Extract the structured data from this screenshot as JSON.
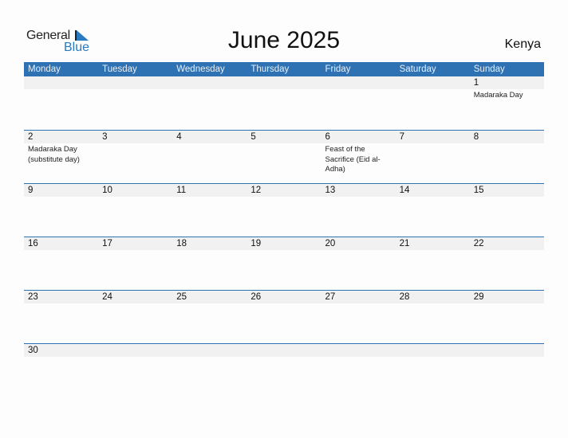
{
  "logo": {
    "word1": "General",
    "word2": "Blue",
    "accent": "#2a7ac0"
  },
  "title": "June 2025",
  "country": "Kenya",
  "colors": {
    "header_bg": "#2e72b3",
    "band_bg": "#f1f1f1"
  },
  "weekdays": [
    "Monday",
    "Tuesday",
    "Wednesday",
    "Thursday",
    "Friday",
    "Saturday",
    "Sunday"
  ],
  "weeks": [
    [
      {
        "day": "",
        "holiday": ""
      },
      {
        "day": "",
        "holiday": ""
      },
      {
        "day": "",
        "holiday": ""
      },
      {
        "day": "",
        "holiday": ""
      },
      {
        "day": "",
        "holiday": ""
      },
      {
        "day": "",
        "holiday": ""
      },
      {
        "day": "1",
        "holiday": "Madaraka Day"
      }
    ],
    [
      {
        "day": "2",
        "holiday": "Madaraka Day (substitute day)"
      },
      {
        "day": "3",
        "holiday": ""
      },
      {
        "day": "4",
        "holiday": ""
      },
      {
        "day": "5",
        "holiday": ""
      },
      {
        "day": "6",
        "holiday": "Feast of the Sacrifice (Eid al-Adha)"
      },
      {
        "day": "7",
        "holiday": ""
      },
      {
        "day": "8",
        "holiday": ""
      }
    ],
    [
      {
        "day": "9",
        "holiday": ""
      },
      {
        "day": "10",
        "holiday": ""
      },
      {
        "day": "11",
        "holiday": ""
      },
      {
        "day": "12",
        "holiday": ""
      },
      {
        "day": "13",
        "holiday": ""
      },
      {
        "day": "14",
        "holiday": ""
      },
      {
        "day": "15",
        "holiday": ""
      }
    ],
    [
      {
        "day": "16",
        "holiday": ""
      },
      {
        "day": "17",
        "holiday": ""
      },
      {
        "day": "18",
        "holiday": ""
      },
      {
        "day": "19",
        "holiday": ""
      },
      {
        "day": "20",
        "holiday": ""
      },
      {
        "day": "21",
        "holiday": ""
      },
      {
        "day": "22",
        "holiday": ""
      }
    ],
    [
      {
        "day": "23",
        "holiday": ""
      },
      {
        "day": "24",
        "holiday": ""
      },
      {
        "day": "25",
        "holiday": ""
      },
      {
        "day": "26",
        "holiday": ""
      },
      {
        "day": "27",
        "holiday": ""
      },
      {
        "day": "28",
        "holiday": ""
      },
      {
        "day": "29",
        "holiday": ""
      }
    ],
    [
      {
        "day": "30",
        "holiday": ""
      },
      {
        "day": "",
        "holiday": ""
      },
      {
        "day": "",
        "holiday": ""
      },
      {
        "day": "",
        "holiday": ""
      },
      {
        "day": "",
        "holiday": ""
      },
      {
        "day": "",
        "holiday": ""
      },
      {
        "day": "",
        "holiday": ""
      }
    ]
  ]
}
